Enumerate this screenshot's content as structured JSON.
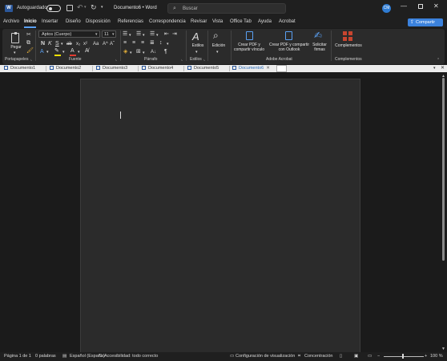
{
  "titlebar": {
    "autosave_label": "Autoguardado",
    "doc_title": "Documento6  •  Word",
    "search_placeholder": "Buscar",
    "avatar_initials": "CM",
    "undo_glyph": "↶",
    "redo_glyph": "↻",
    "more_glyph": "▾",
    "search_glyph": "⌕",
    "minimize_glyph": "—",
    "close_glyph": "✕"
  },
  "ribbon_tabs": [
    "Archivo",
    "Inicio",
    "Insertar",
    "Diseño",
    "Disposición",
    "Referencias",
    "Correspondencia",
    "Revisar",
    "Vista",
    "Office Tab",
    "Ayuda",
    "Acrobat"
  ],
  "active_tab": "Inicio",
  "share_label": "Compartir",
  "clipboard": {
    "paste_label": "Pegar",
    "group_label": "Portapapeles"
  },
  "font": {
    "name": "Aptos (Cuerpo)",
    "size": "11",
    "group_label": "Fuente"
  },
  "paragraph": {
    "group_label": "Párrafo"
  },
  "styles": {
    "label": "Estilos",
    "group_label": "Estilos"
  },
  "editing": {
    "label": "Edición"
  },
  "acrobat": {
    "create_pdf_link": "Crear PDF y compartir vínculo",
    "create_pdf_outlook": "Crear PDF y compartir con Outlook",
    "request_signatures": "Solicitar firmas",
    "group_label": "Adobe Acrobat"
  },
  "addins": {
    "label": "Complementos",
    "group_label": "Complementos"
  },
  "doc_tabs": [
    "Documento1",
    "Documento2",
    "Documento3",
    "Documento4",
    "Documento5",
    "Documento6"
  ],
  "active_doc_tab": "Documento6",
  "statusbar": {
    "page": "Página 1 de 1",
    "words": "0 palabras",
    "language": "Español (España)",
    "accessibility": "Accesibilidad: todo correcto",
    "display_settings": "Configuración de visualización",
    "focus": "Concentración",
    "zoom": "100 %",
    "zoom_fraction": 0.5
  },
  "colors": {
    "accent": "#3b82dd",
    "word_blue": "#2b579a",
    "highlight_yellow": "#f5e000",
    "font_red": "#e03c31",
    "addins_red": "#c8452f"
  }
}
